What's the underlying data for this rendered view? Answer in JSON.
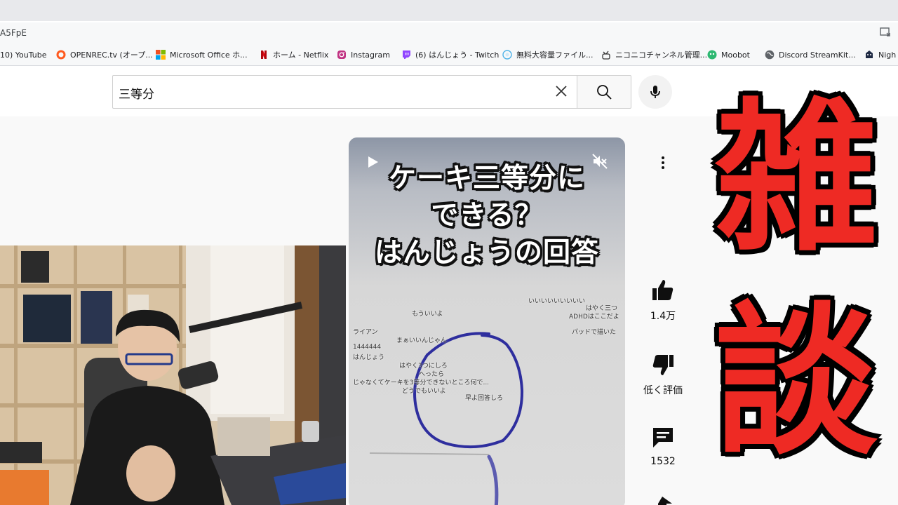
{
  "browser": {
    "url_fragment": "A5FpE",
    "bookmarks": [
      {
        "label": "10) YouTube",
        "icon": "youtube-icon",
        "color": "#ff0000"
      },
      {
        "label": "OPENREC.tv (オープ...",
        "icon": "openrec-icon",
        "color": "#ff5a1f"
      },
      {
        "label": "Microsoft Office ホ...",
        "icon": "microsoft-icon",
        "color": "#f25022"
      },
      {
        "label": "ホーム - Netflix",
        "icon": "netflix-icon",
        "color": "#e50914"
      },
      {
        "label": "Instagram",
        "icon": "instagram-icon",
        "color": "#c13584"
      },
      {
        "label": "(6) はんじょう - Twitch",
        "icon": "twitch-icon",
        "color": "#9146ff"
      },
      {
        "label": "無料大容量ファイル...",
        "icon": "file-transfer-icon",
        "color": "#4fb3e8"
      },
      {
        "label": "ニコニコチャンネル管理...",
        "icon": "niconico-icon",
        "color": "#333333"
      },
      {
        "label": "Moobot",
        "icon": "moobot-icon",
        "color": "#2eb872"
      },
      {
        "label": "Discord StreamKit...",
        "icon": "globe-icon",
        "color": "#5f6368"
      },
      {
        "label": "Nigh",
        "icon": "nightbot-icon",
        "color": "#1f2a44"
      }
    ]
  },
  "search": {
    "query": "三等分"
  },
  "player": {
    "title_lines": [
      "ケーキ三等分に",
      "できる？",
      "はんじょうの回答"
    ],
    "comments": [
      "もういいよ",
      "まぁいいんじゃん",
      "ライアン",
      "1444444",
      "はんじょう",
      "はやく3つにしろ",
      "へったら",
      "じゃなくてケーキを3等分できないところ何で...",
      "どうでもいいよ",
      "早よ回答しろ",
      "はやく三つ",
      "ADHDはここだよ",
      "パッドで描いた",
      "いいいいいいいいい"
    ]
  },
  "actions": {
    "like_count": "1.4万",
    "dislike_label": "低く評価",
    "comment_count": "1532"
  },
  "overlay_title": [
    "雑",
    "談"
  ],
  "colors": {
    "accent_red": "#ee2a24",
    "scribble_blue": "#2e2e9e"
  }
}
